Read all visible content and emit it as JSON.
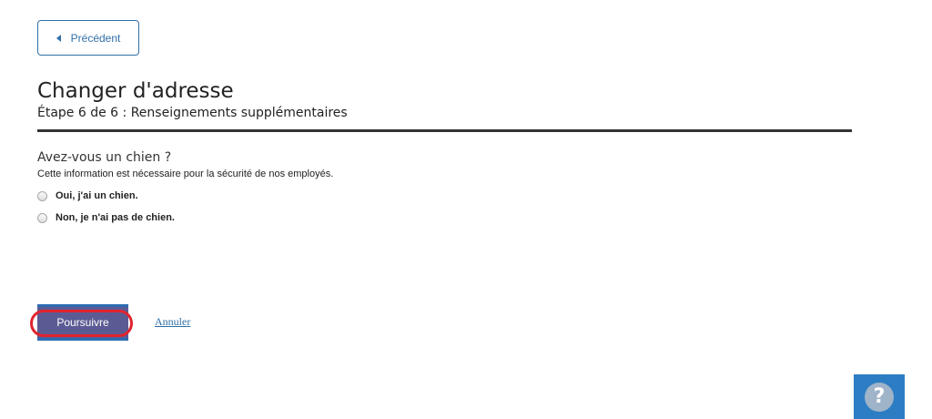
{
  "nav": {
    "back_label": "Précédent",
    "back_icon": "caret-left-icon"
  },
  "header": {
    "title": "Changer d'adresse",
    "step": "Étape 6 de 6 : Renseignements supplémentaires"
  },
  "form": {
    "question": "Avez-vous un chien ?",
    "hint": "Cette information est nécessaire pour la sécurité de nos employés.",
    "options": [
      {
        "label": "Oui, j'ai un chien.",
        "selected": false
      },
      {
        "label": "Non, je n'ai pas de chien.",
        "selected": false
      }
    ]
  },
  "actions": {
    "continue_label": "Poursuivre",
    "cancel_label": "Annuler"
  },
  "help": {
    "label": "?",
    "icon": "question-mark-icon"
  },
  "colors": {
    "accent_blue": "#2f6fa8",
    "continue_bg": "#5b5b94",
    "highlight_red": "#e0242f",
    "help_bg": "#2d7dc4"
  }
}
